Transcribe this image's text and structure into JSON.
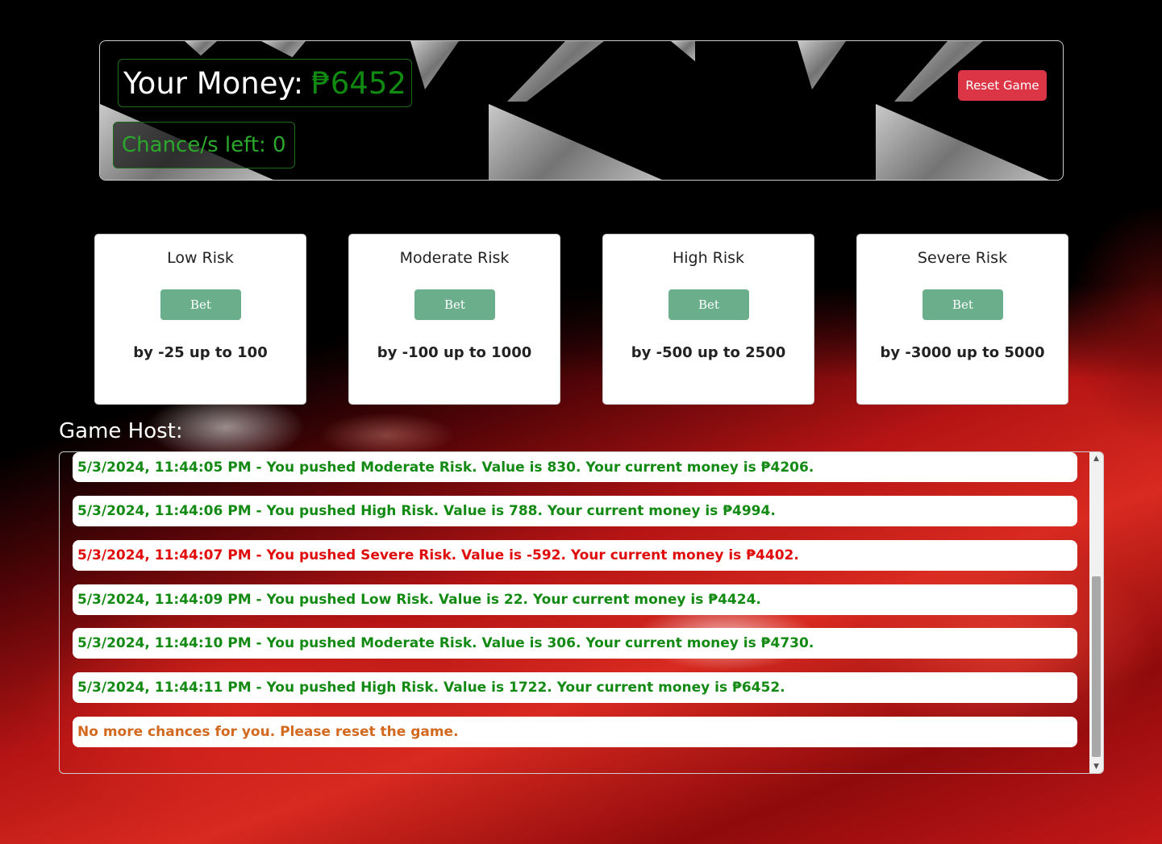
{
  "header": {
    "money_label": "Your Money:",
    "money_value": "₱6452",
    "chances_text": "Chance/s left: 0",
    "reset_label": "Reset Game"
  },
  "cards": [
    {
      "title": "Low Risk",
      "button": "Bet",
      "range": "by -25 up to 100"
    },
    {
      "title": "Moderate Risk",
      "button": "Bet",
      "range": "by -100 up to 1000"
    },
    {
      "title": "High Risk",
      "button": "Bet",
      "range": "by -500 up to 2500"
    },
    {
      "title": "Severe Risk",
      "button": "Bet",
      "range": "by -3000 up to 5000"
    }
  ],
  "host": {
    "label": "Game Host:",
    "messages": [
      {
        "text": "5/3/2024, 11:44:05 PM - You pushed Moderate Risk. Value is 830. Your current money is ₱4206.",
        "color": "#138a13"
      },
      {
        "text": "5/3/2024, 11:44:06 PM - You pushed High Risk. Value is 788. Your current money is ₱4994.",
        "color": "#138a13"
      },
      {
        "text": "5/3/2024, 11:44:07 PM - You pushed Severe Risk. Value is -592. Your current money is ₱4402.",
        "color": "#e00b0b"
      },
      {
        "text": "5/3/2024, 11:44:09 PM - You pushed Low Risk. Value is 22. Your current money is ₱4424.",
        "color": "#138a13"
      },
      {
        "text": "5/3/2024, 11:44:10 PM - You pushed Moderate Risk. Value is 306. Your current money is ₱4730.",
        "color": "#138a13"
      },
      {
        "text": "5/3/2024, 11:44:11 PM - You pushed High Risk. Value is 1722. Your current money is ₱6452.",
        "color": "#138a13"
      },
      {
        "text": "No more chances for you. Please reset the game.",
        "color": "#d2691e"
      }
    ]
  },
  "colors": {
    "accent_green": "#118a11",
    "danger": "#dc3545",
    "bet_button": "#6aae8c"
  }
}
